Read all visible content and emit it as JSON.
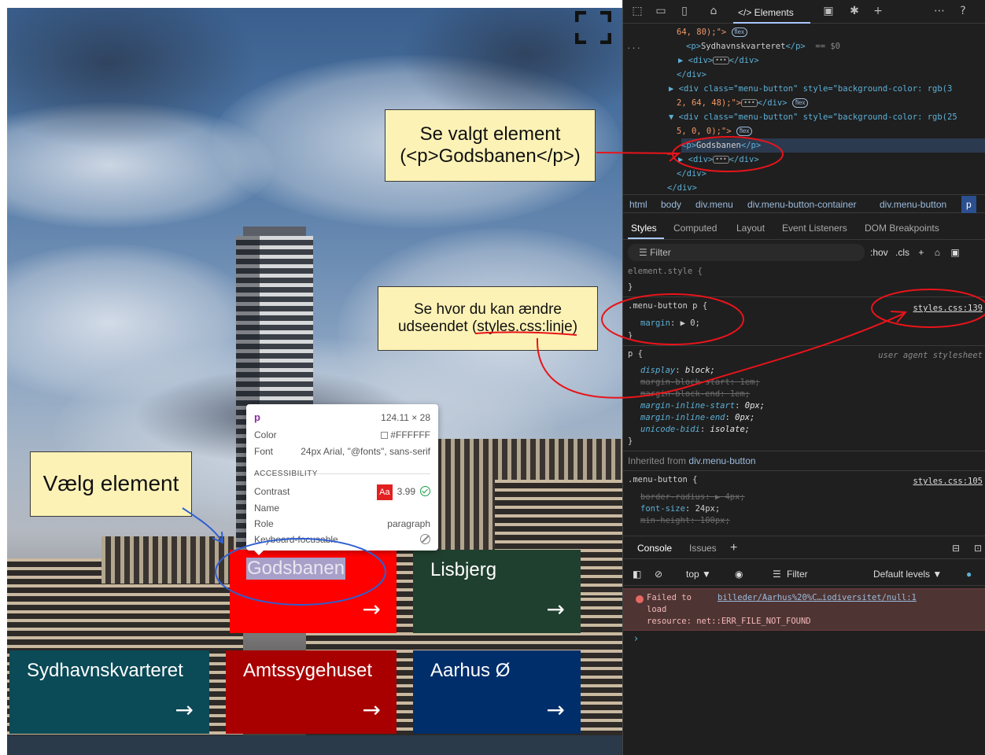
{
  "tiles": {
    "godsbanen": {
      "label": "Godsbanen",
      "arrow": "→",
      "color": "#ff0000"
    },
    "lisbjerg": {
      "label": "Lisbjerg",
      "arrow": "→",
      "color": "#20402f"
    },
    "sydhavn": {
      "label": "Sydhavnskvarteret",
      "arrow": "→",
      "color": "#0b4a57"
    },
    "amtssygehuset": {
      "label": "Amtssygehuset",
      "arrow": "→",
      "color": "#a80000"
    },
    "aarhus_o": {
      "label": "Aarhus Ø",
      "arrow": "→",
      "color": "#002e6b"
    }
  },
  "tooltip": {
    "tag": "p",
    "size": "124.11 × 28",
    "color_label": "Color",
    "color_value": "#FFFFFF",
    "font_label": "Font",
    "font_value": "24px Arial, \"@fonts\", sans-serif",
    "accessibility_label": "ACCESSIBILITY",
    "contrast_label": "Contrast",
    "contrast_badge": "Aa",
    "contrast_value": "3.99",
    "name_label": "Name",
    "role_label": "Role",
    "role_value": "paragraph",
    "keyboard_label": "Keyboard-focusable"
  },
  "notes": {
    "select_element": "Vælg element",
    "see_selected_line1": "Se valgt element",
    "see_selected_line2": "(<p>Godsbanen</p>)",
    "see_where_line1": "Se hvor du kan ændre",
    "see_where_line2": "udseendet (styles.css:linje)"
  },
  "devtools": {
    "elements_tab": "</> Elements",
    "more_icon": "⋯",
    "dom": {
      "l1": "64, 80);\">",
      "l1_pill": "flex",
      "l2_open": "<p>",
      "l2_text": "Sydhavnskvarteret",
      "l2_close": "</p>",
      "l2_dim": "== $0",
      "l2_dots": "...",
      "l3": "▶ <div>",
      "l3_ellip": "•••",
      "l3_end": "</div>",
      "l4": "</div>",
      "l5": "▶ <div class=\"menu-button\" style=\"background-color: rgb(3",
      "l6": "2, 64, 48);\">",
      "l6_ellip": "•••",
      "l6_end": "</div>",
      "l6_pill": "flex",
      "l7": "▼ <div class=\"menu-button\" style=\"background-color: rgb(25",
      "l8": "5, 0, 0);\">",
      "l8_pill": "flex",
      "l9_open": "<p>",
      "l9_text": "Godsbanen",
      "l9_close": "</p>",
      "l10": "▶ <div>",
      "l10_ellip": "•••",
      "l10_end": "</div>",
      "l11": "</div>",
      "l12": "</div>"
    },
    "breadcrumb": [
      "html",
      "body",
      "div.menu",
      "div.menu-button-container",
      "div.menu-button",
      "p"
    ],
    "subtabs": [
      "Styles",
      "Computed",
      "Layout",
      "Event Listeners",
      "DOM Breakpoints"
    ],
    "filter_placeholder": "Filter",
    "filter_hov": ":hov",
    "filter_cls": ".cls",
    "filter_plus": "+",
    "styles": {
      "element_style": "element.style {",
      "close": "}",
      "rule1_selector": ".menu-button p {",
      "rule1_source": "styles.css:139",
      "rule1_prop": "margin",
      "rule1_val": "▶ 0;",
      "rule2_selector": "p {",
      "rule2_source": "user agent stylesheet",
      "ua_props": [
        {
          "prop": "display",
          "val": "block;",
          "struck": false
        },
        {
          "prop": "margin-block-start",
          "val": "1em;",
          "struck": true
        },
        {
          "prop": "margin-block-end",
          "val": "1em;",
          "struck": true
        },
        {
          "prop": "margin-inline-start",
          "val": "0px;",
          "struck": false
        },
        {
          "prop": "margin-inline-end",
          "val": "0px;",
          "struck": false
        },
        {
          "prop": "unicode-bidi",
          "val": "isolate;",
          "struck": false
        }
      ],
      "inherited_label": "Inherited from",
      "inherited_from": "div.menu-button",
      "rule3_selector": ".menu-button {",
      "rule3_source": "styles.css:105",
      "rule3_props": [
        {
          "prop": "border-radius",
          "val": "▶ 4px;",
          "struck": true
        },
        {
          "prop": "font-size",
          "val": "24px;",
          "struck": false
        },
        {
          "prop": "min-height",
          "val": "100px;",
          "struck": true
        }
      ]
    },
    "console_tab": "Console",
    "issues_tab": "Issues",
    "console_plus": "+",
    "context": "top ▼",
    "console_filter": "Filter",
    "levels": "Default levels ▼",
    "error": {
      "line1a": "Failed to",
      "link": "billeder/Aarhus%20%C…iodiversitet/null:1",
      "line2": "load",
      "line3": "resource: net::ERR_FILE_NOT_FOUND"
    },
    "prompt": "›"
  }
}
